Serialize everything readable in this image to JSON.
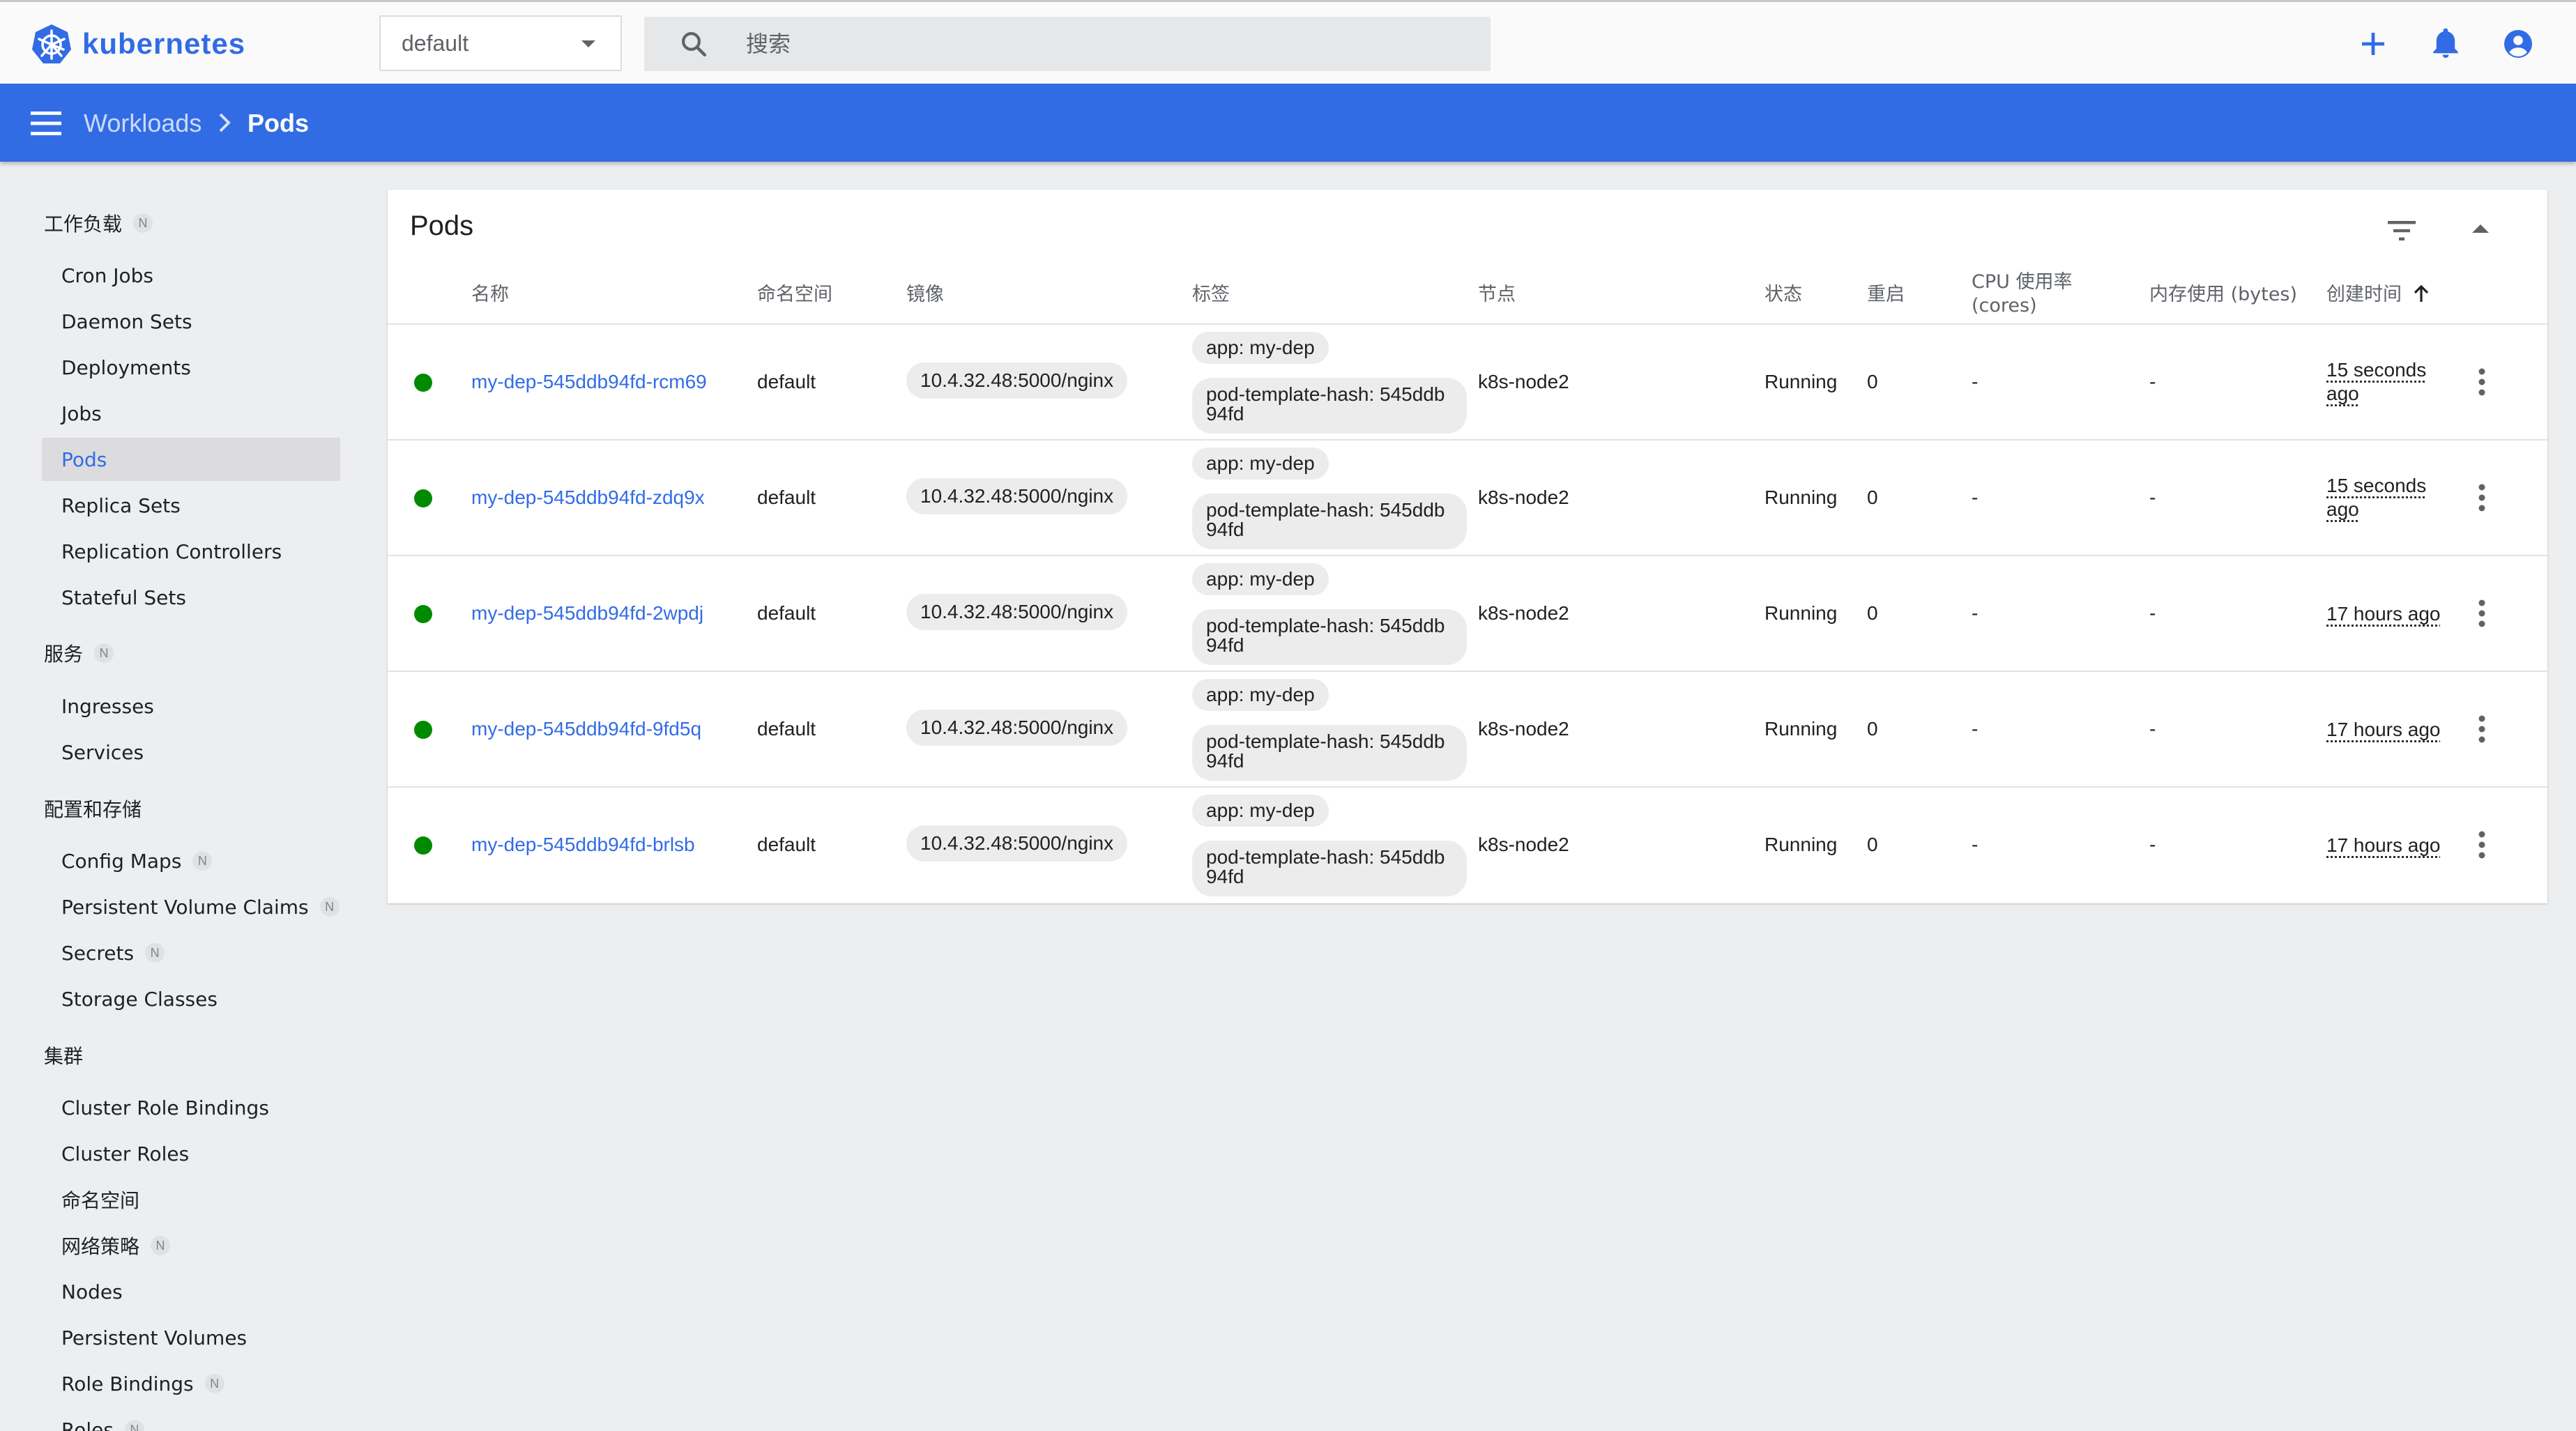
{
  "app": {
    "name": "kubernetes"
  },
  "header": {
    "namespace": "default",
    "search_placeholder": "搜索",
    "icons": [
      "add-icon",
      "notifications-icon",
      "account-icon"
    ]
  },
  "breadcrumb": {
    "parent": "Workloads",
    "current": "Pods"
  },
  "sidebar": {
    "sections": [
      {
        "title": "工作负载",
        "badge": "N",
        "items": [
          {
            "label": "Cron Jobs"
          },
          {
            "label": "Daemon Sets"
          },
          {
            "label": "Deployments"
          },
          {
            "label": "Jobs"
          },
          {
            "label": "Pods",
            "active": true
          },
          {
            "label": "Replica Sets"
          },
          {
            "label": "Replication Controllers"
          },
          {
            "label": "Stateful Sets"
          }
        ]
      },
      {
        "title": "服务",
        "badge": "N",
        "items": [
          {
            "label": "Ingresses"
          },
          {
            "label": "Services"
          }
        ]
      },
      {
        "title": "配置和存储",
        "items": [
          {
            "label": "Config Maps",
            "badge": "N"
          },
          {
            "label": "Persistent Volume Claims",
            "badge": "N"
          },
          {
            "label": "Secrets",
            "badge": "N"
          },
          {
            "label": "Storage Classes"
          }
        ]
      },
      {
        "title": "集群",
        "items": [
          {
            "label": "Cluster Role Bindings"
          },
          {
            "label": "Cluster Roles"
          },
          {
            "label": "命名空间"
          },
          {
            "label": "网络策略",
            "badge": "N"
          },
          {
            "label": "Nodes"
          },
          {
            "label": "Persistent Volumes"
          },
          {
            "label": "Role Bindings",
            "badge": "N"
          },
          {
            "label": "Roles",
            "badge": "N"
          }
        ]
      }
    ]
  },
  "card": {
    "title": "Pods",
    "columns": {
      "name": "名称",
      "namespace": "命名空间",
      "image": "镜像",
      "labels": "标签",
      "node": "节点",
      "status": "状态",
      "restarts": "重启",
      "cpu_1": "CPU 使用率",
      "cpu_2": "(cores)",
      "memory": "内存使用 (bytes)",
      "created": "创建时间"
    },
    "rows": [
      {
        "name": "my-dep-545ddb94fd-rcm69",
        "namespace": "default",
        "image": "10.4.32.48:5000/nginx",
        "label_app": "app: my-dep",
        "label_hash_1": "pod-template-hash: 545ddb",
        "label_hash_2": "94fd",
        "node": "k8s-node2",
        "status": "Running",
        "restarts": "0",
        "cpu": "-",
        "memory": "-",
        "created_1": "15 seconds",
        "created_2": "ago"
      },
      {
        "name": "my-dep-545ddb94fd-zdq9x",
        "namespace": "default",
        "image": "10.4.32.48:5000/nginx",
        "label_app": "app: my-dep",
        "label_hash_1": "pod-template-hash: 545ddb",
        "label_hash_2": "94fd",
        "node": "k8s-node2",
        "status": "Running",
        "restarts": "0",
        "cpu": "-",
        "memory": "-",
        "created_1": "15 seconds",
        "created_2": "ago"
      },
      {
        "name": "my-dep-545ddb94fd-2wpdj",
        "namespace": "default",
        "image": "10.4.32.48:5000/nginx",
        "label_app": "app: my-dep",
        "label_hash_1": "pod-template-hash: 545ddb",
        "label_hash_2": "94fd",
        "node": "k8s-node2",
        "status": "Running",
        "restarts": "0",
        "cpu": "-",
        "memory": "-",
        "created_1": "17 hours ago",
        "created_2": ""
      },
      {
        "name": "my-dep-545ddb94fd-9fd5q",
        "namespace": "default",
        "image": "10.4.32.48:5000/nginx",
        "label_app": "app: my-dep",
        "label_hash_1": "pod-template-hash: 545ddb",
        "label_hash_2": "94fd",
        "node": "k8s-node2",
        "status": "Running",
        "restarts": "0",
        "cpu": "-",
        "memory": "-",
        "created_1": "17 hours ago",
        "created_2": ""
      },
      {
        "name": "my-dep-545ddb94fd-brlsb",
        "namespace": "default",
        "image": "10.4.32.48:5000/nginx",
        "label_app": "app: my-dep",
        "label_hash_1": "pod-template-hash: 545ddb",
        "label_hash_2": "94fd",
        "node": "k8s-node2",
        "status": "Running",
        "restarts": "0",
        "cpu": "-",
        "memory": "-",
        "created_1": "17 hours ago",
        "created_2": ""
      }
    ]
  },
  "colors": {
    "brand": "#326ce5",
    "status_ok": "#008a00"
  }
}
